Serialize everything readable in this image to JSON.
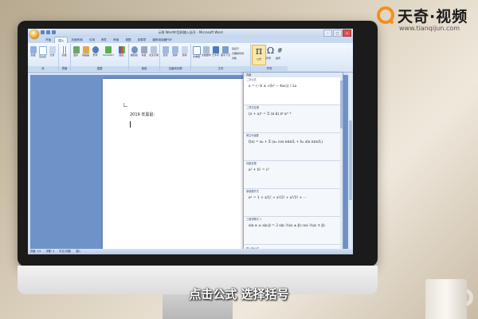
{
  "logo": {
    "brand": "天奇·视频",
    "url": "www.tianqijun.com"
  },
  "window": {
    "title": "示例 Word中怎样输入括号 - Microsoft Word",
    "controls": [
      "-",
      "□",
      "×"
    ]
  },
  "tabs": [
    "开始",
    "插入",
    "页面布局",
    "引用",
    "邮件",
    "审阅",
    "视图",
    "加载项",
    "福昕阅读器PDF"
  ],
  "ribbon": {
    "groups": [
      {
        "label": "页",
        "buttons": [
          "封面",
          "空白页",
          "分页"
        ]
      },
      {
        "label": "表格",
        "buttons": [
          "表格"
        ]
      },
      {
        "label": "插图",
        "buttons": [
          "图片",
          "剪贴画",
          "形状",
          "SmartArt",
          "图表"
        ]
      },
      {
        "label": "链接",
        "buttons": [
          "超链接",
          "书签",
          "交叉引用"
        ]
      },
      {
        "label": "页眉和页脚",
        "buttons": [
          "页眉",
          "页脚",
          "页码"
        ]
      },
      {
        "label": "文本",
        "buttons": [
          "文本框",
          "文档部件",
          "艺术字",
          "首字下沉"
        ]
      },
      {
        "label": "符号",
        "buttons": [
          "公式",
          "符号",
          "编号"
        ]
      }
    ],
    "text_small": [
      "签名行",
      "日期和时间",
      "对象"
    ],
    "equation_label": "公式",
    "symbol_label": "符号",
    "number_label": "编号"
  },
  "document": {
    "line1": "2019 年黑鼠:"
  },
  "equation_panel": {
    "header": "内置",
    "items": [
      {
        "label": "二次公式",
        "formula": "x = (−b ± √(b² − 4ac)) / 2a"
      },
      {
        "label": "二项式定理",
        "formula": "(x + a)ⁿ = Σ (n k) xᵏ aⁿ⁻ᵏ"
      },
      {
        "label": "傅立叶级数",
        "formula": "f(x) = a₀ + Σ (aₙ cos nπx/L + bₙ sin nπx/L)"
      },
      {
        "label": "勾股定理",
        "formula": "a² + b² = c²"
      },
      {
        "label": "泰勒展开式",
        "formula": "eˣ = 1 + x/1! + x²/2! + x³/3! + ⋯"
      },
      {
        "label": "三角恒等式 1",
        "formula": "sin α ± sin β = 2 sin ½(α ± β) cos ½(α ∓ β)"
      }
    ],
    "more": "插入新公式"
  },
  "statusbar": {
    "page": "页面: 1/1",
    "words": "字数: 4",
    "lang": "中文(中国)",
    "mode": "插入"
  },
  "caption": "点击公式 选择括号"
}
